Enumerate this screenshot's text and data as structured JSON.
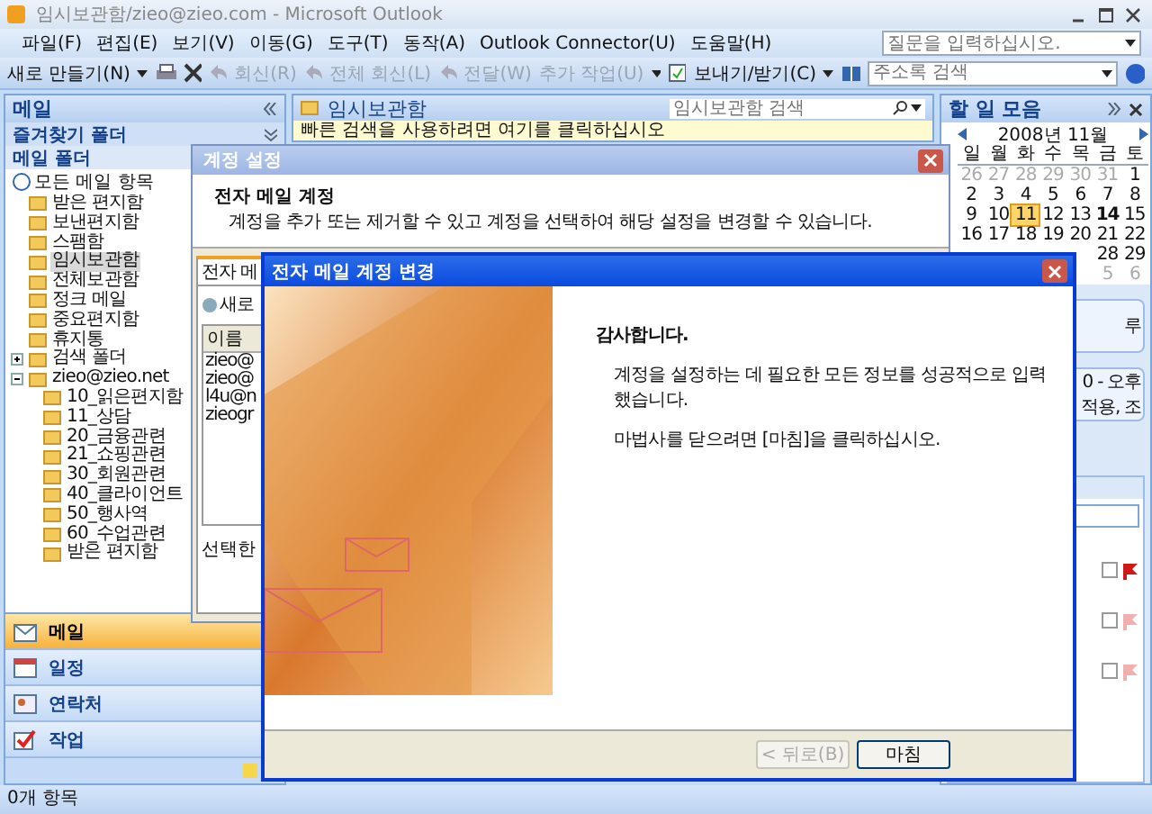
{
  "window": {
    "title": "임시보관함/zieo@zieo.com - Microsoft Outlook"
  },
  "menu": [
    "파일(F)",
    "편집(E)",
    "보기(V)",
    "이동(G)",
    "도구(T)",
    "동작(A)",
    "Outlook Connector(U)",
    "도움말(H)"
  ],
  "help_box": {
    "placeholder": "질문을 입력하십시오."
  },
  "toolbar": [
    {
      "label": "새로 만들기(N)",
      "disabled": false,
      "kind": "new"
    },
    {
      "label": "회신(R)",
      "disabled": true,
      "kind": "reply"
    },
    {
      "label": "전체 회신(L)",
      "disabled": true,
      "kind": "reply"
    },
    {
      "label": "전달(W)",
      "disabled": true,
      "kind": "reply"
    },
    {
      "label": "추가 작업(U)",
      "disabled": true,
      "kind": "menu"
    },
    {
      "label": "보내기/받기(C)",
      "disabled": false,
      "kind": "sendreceive"
    }
  ],
  "address_search": {
    "placeholder": "주소록 검색"
  },
  "nav": {
    "title": "메일",
    "favorites": "즐겨찾기 폴더",
    "mail_folders": "메일 폴더",
    "all_items": "모든 메일 항목",
    "folders": [
      {
        "label": "받은 편지함",
        "selected": false
      },
      {
        "label": "보낸편지함",
        "selected": false
      },
      {
        "label": "스팸함",
        "selected": false
      },
      {
        "label": "임시보관함",
        "selected": true
      },
      {
        "label": "전체보관함",
        "selected": false
      },
      {
        "label": "정크 메일",
        "selected": false
      },
      {
        "label": "중요편지함",
        "selected": false
      },
      {
        "label": "휴지통",
        "selected": false
      },
      {
        "label": "검색 폴더",
        "selected": false,
        "expanded": false
      },
      {
        "label": "zieo@zieo.net",
        "selected": false,
        "expanded": true,
        "children": [
          {
            "label": "10_읽은편지함",
            "selected": false
          },
          {
            "label": "11_상담",
            "selected": false
          },
          {
            "label": "20_금융관련",
            "selected": false
          },
          {
            "label": "21_쇼핑관련",
            "selected": false
          },
          {
            "label": "30_회원관련",
            "selected": false
          },
          {
            "label": "40_클라이언트",
            "selected": false
          },
          {
            "label": "50_행사역",
            "selected": false
          },
          {
            "label": "60_수업관련",
            "selected": false
          },
          {
            "label": "받은 편지함",
            "selected": false
          }
        ]
      }
    ],
    "buttons": [
      {
        "label": "메일",
        "selected": true,
        "kind": "mail"
      },
      {
        "label": "일정",
        "selected": false,
        "kind": "calendar"
      },
      {
        "label": "연락처",
        "selected": false,
        "kind": "contacts"
      },
      {
        "label": "작업",
        "selected": false,
        "kind": "tasks"
      }
    ]
  },
  "folder_view": {
    "title": "임시보관함",
    "search": {
      "placeholder": "임시보관함 검색"
    },
    "info_bar": "빠른 검색을 사용하려면 여기를 클릭하십시오"
  },
  "todo_bar": {
    "title": "할 일 모음",
    "month": "2008년 11월",
    "weekdays": [
      "일",
      "월",
      "화",
      "수",
      "목",
      "금",
      "토"
    ],
    "weeks": [
      [
        {
          "d": "26",
          "other": true
        },
        {
          "d": "27",
          "other": true
        },
        {
          "d": "28",
          "other": true
        },
        {
          "d": "29",
          "other": true
        },
        {
          "d": "30",
          "other": true
        },
        {
          "d": "31",
          "other": true
        },
        {
          "d": "1",
          "other": false
        }
      ],
      [
        {
          "d": "2",
          "other": false
        },
        {
          "d": "3",
          "other": false
        },
        {
          "d": "4",
          "other": false
        },
        {
          "d": "5",
          "other": false
        },
        {
          "d": "6",
          "other": false
        },
        {
          "d": "7",
          "other": false
        },
        {
          "d": "8",
          "other": false
        }
      ],
      [
        {
          "d": "9",
          "other": false
        },
        {
          "d": "10",
          "other": false
        },
        {
          "d": "11",
          "other": false,
          "today": true
        },
        {
          "d": "12",
          "other": false
        },
        {
          "d": "13",
          "other": false
        },
        {
          "d": "14",
          "other": false,
          "bold": true
        },
        {
          "d": "15",
          "other": false
        }
      ],
      [
        {
          "d": "16",
          "other": false
        },
        {
          "d": "17",
          "other": false
        },
        {
          "d": "18",
          "other": false
        },
        {
          "d": "19",
          "other": false
        },
        {
          "d": "20",
          "other": false
        },
        {
          "d": "21",
          "other": false
        },
        {
          "d": "22",
          "other": false
        }
      ],
      [
        {
          "d": "28",
          "other": false
        },
        {
          "d": "29",
          "other": false
        }
      ],
      [
        {
          "d": "5",
          "other": true
        },
        {
          "d": "6",
          "other": true
        }
      ]
    ],
    "appointments": [
      [
        "루"
      ],
      [
        "0 - 오후",
        "적용, 조"
      ]
    ],
    "tasks": [
      {
        "checked": false,
        "color": "#d01818"
      },
      {
        "checked": false,
        "color": "#f0b0b0"
      },
      {
        "checked": false,
        "color": "#f0b0b0"
      }
    ]
  },
  "status_bar": "0개 항목",
  "account_dialog": {
    "title": "계정 설정",
    "heading": "전자 메일 계정",
    "description": "계정을 추가 또는 제거할 수 있고 계정을 선택하여 해당 설정을 변경할 수 있습니다.",
    "tab": "전자 메",
    "new_button": "새로",
    "column": "이름",
    "rows": [
      "zieo@",
      "zieo@",
      "l4u@n",
      "zieogr"
    ],
    "selected_label": "선택한"
  },
  "wizard": {
    "title": "전자 메일 계정 변경",
    "heading": "감사합니다.",
    "lines": [
      "계정을 설정하는 데 필요한 모든 정보를 성공적으로 입력했습니다.",
      "마법사를 닫으려면 [마침]을 클릭하십시오."
    ],
    "buttons": [
      {
        "label": "< 뒤로(B)",
        "disabled": true
      },
      {
        "label": "마침",
        "disabled": false
      }
    ]
  }
}
